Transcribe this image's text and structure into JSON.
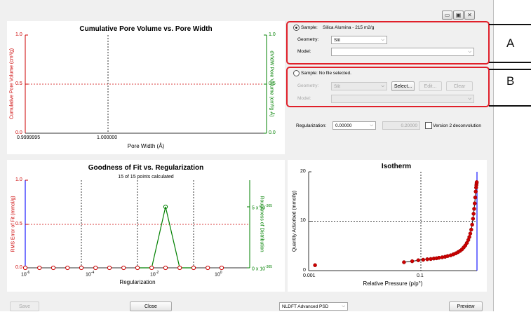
{
  "window": {
    "buttons": [
      "minimize",
      "maximize",
      "close"
    ]
  },
  "pore_chart": {
    "title": "Cumulative Pore Volume vs. Pore Width",
    "y_left_label": "Cumulative Pore Volume (cm³/g)",
    "y_right_label": "dV/dW Pore Volume (cm³/g·Å)",
    "x_label": "Pore Width (Å)",
    "y_left_ticks": [
      "1.0",
      "0.5",
      "0.0"
    ],
    "y_right_ticks": [
      "1.0",
      "0.5",
      "0.0"
    ],
    "x_ticks": [
      "0.9999995",
      "1.000000"
    ]
  },
  "fit_chart": {
    "title": "Goodness of Fit vs. Regularization",
    "subtitle": "15 of 15 points calculated",
    "y_left_label": "RMS Error of Fit (mmol/g)",
    "y_right_label": "Roughness of Distribution",
    "x_label": "Regularization",
    "y_left_ticks": [
      "1.0",
      "0.5",
      "0.0"
    ],
    "y_right_ticks": [
      {
        "mant": "5 x 10",
        "exp": "-305"
      },
      {
        "mant": "0 x 10",
        "exp": "-305"
      }
    ],
    "x_ticks": [
      {
        "mant": "10",
        "exp": "-6"
      },
      {
        "mant": "10",
        "exp": "-4"
      },
      {
        "mant": "10",
        "exp": "-2"
      },
      {
        "mant": "10",
        "exp": "0"
      }
    ]
  },
  "isotherm_chart": {
    "title": "Isotherm",
    "y_label": "Quantity Adsorbed (mmol/g)",
    "x_label": "Relative Pressure (p/p°)",
    "y_ticks": [
      "20",
      "10",
      "0"
    ],
    "x_ticks": [
      "0.001",
      "0.1"
    ]
  },
  "chart_data": [
    {
      "type": "line",
      "title": "Cumulative Pore Volume vs. Pore Width",
      "xlabel": "Pore Width (Å)",
      "ylabel": "Cumulative Pore Volume (cm³/g)",
      "y2label": "dV/dW Pore Volume (cm³/g·Å)",
      "xlim": [
        0.9999995,
        1.0000005
      ],
      "ylim": [
        0,
        1.0
      ],
      "series": []
    },
    {
      "type": "line",
      "title": "Goodness of Fit vs. Regularization",
      "xlabel": "Regularization",
      "ylabel": "RMS Error of Fit (mmol/g)",
      "y2label": "Roughness of Distribution",
      "x_scale": "log",
      "xlim": [
        1e-06,
        100
      ],
      "ylim": [
        0,
        1.0
      ],
      "series": [
        {
          "axis": "left",
          "color": "#cc0000",
          "marker": "circle",
          "x": [
            1e-06,
            3.2e-06,
            1e-05,
            3.2e-05,
            0.0001,
            0.00032,
            0.001,
            0.0032,
            0.01,
            0.032,
            0.1,
            0.32,
            1,
            3.2,
            10
          ],
          "y": [
            0,
            0,
            0,
            0,
            0,
            0,
            0,
            0,
            0,
            0,
            0,
            0,
            0,
            0,
            0
          ]
        },
        {
          "axis": "right",
          "color": "#008000",
          "marker": "circle",
          "x": [
            0.01,
            0.032,
            0.1,
            0.32,
            1
          ],
          "y": [
            0,
            0,
            5e-305,
            0,
            0
          ]
        }
      ]
    },
    {
      "type": "scatter",
      "title": "Isotherm",
      "xlabel": "Relative Pressure (p/p°)",
      "ylabel": "Quantity Adsorbed (mmol/g)",
      "x_scale": "log",
      "xlim": [
        0.001,
        1.0
      ],
      "ylim": [
        0,
        20
      ],
      "series": [
        {
          "color": "#cc0000",
          "marker": "circle",
          "x": [
            0.0013,
            0.05,
            0.07,
            0.09,
            0.11,
            0.13,
            0.15,
            0.17,
            0.19,
            0.21,
            0.24,
            0.27,
            0.3,
            0.34,
            0.38,
            0.42,
            0.46,
            0.5,
            0.54,
            0.58,
            0.62,
            0.66,
            0.7,
            0.73,
            0.76,
            0.79,
            0.82,
            0.85,
            0.87,
            0.89,
            0.91,
            0.93,
            0.95,
            0.965,
            0.975,
            0.985,
            0.99
          ],
          "y": [
            1.1,
            1.7,
            1.9,
            2.1,
            2.2,
            2.3,
            2.35,
            2.45,
            2.5,
            2.6,
            2.7,
            2.8,
            2.95,
            3.1,
            3.3,
            3.5,
            3.75,
            4.0,
            4.3,
            4.7,
            5.1,
            5.6,
            6.2,
            6.8,
            7.5,
            8.3,
            9.3,
            10.5,
            11.5,
            12.5,
            13.6,
            14.8,
            16.0,
            16.8,
            17.3,
            17.7,
            17.9
          ]
        }
      ]
    }
  ],
  "panel_a": {
    "sample_label": "Sample:",
    "sample_value": "Silica Alumina - 215 m2/g",
    "geometry_label": "Geometry:",
    "geometry_value": "Slit",
    "model_label": "Model:",
    "model_value": "",
    "callout": "A"
  },
  "panel_b": {
    "sample_label": "Sample: No file selected.",
    "geometry_label": "Geometry:",
    "geometry_value": "Slit",
    "model_label": "Model:",
    "model_value": "",
    "select_button": "Select...",
    "edit_button": "Edit...",
    "clear_button": "Clear",
    "callout": "B"
  },
  "regularization": {
    "label": "Regularization:",
    "value": "0.00000",
    "numeric": "0.20000",
    "v2_label": "Version 2 deconvolution"
  },
  "footer": {
    "save": "Save",
    "close": "Close",
    "method": "NLDFT Advanced PSD",
    "preview": "Preview"
  },
  "colors": {
    "left_axis": "#cc0000",
    "right_axis": "#008000",
    "callout_border": "#e0202a",
    "isotherm_marker": "#cc0000"
  }
}
